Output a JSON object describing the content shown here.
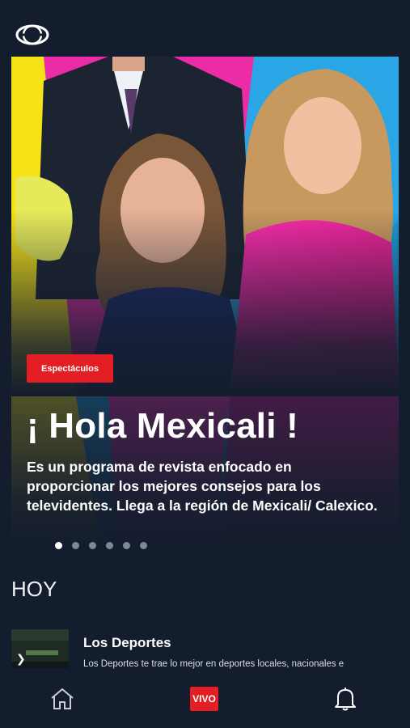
{
  "header": {
    "logo_icon": "televisa-logo-icon"
  },
  "hero": {
    "category_badge": "Espectáculos",
    "title": "¡ Hola Mexicali !",
    "description": "Es un programa de revista enfocado en proporcionar los mejores consejos para los televidentes. Llega a la región de Mexicali/ Calexico.",
    "carousel_total": 6,
    "carousel_active": 1
  },
  "section": {
    "title": "HOY"
  },
  "schedule": [
    {
      "title": "Los Deportes",
      "description": "Los Deportes te trae lo mejor en deportes locales, nacionales e",
      "thumb_icon": "play-arrow-icon"
    }
  ],
  "bottom_nav": {
    "home_icon": "home-icon",
    "live_label": "VIVO",
    "notifications_icon": "bell-icon"
  },
  "colors": {
    "background": "#141d2e",
    "accent_red": "#e31e24",
    "dot_inactive": "#7f8898"
  }
}
